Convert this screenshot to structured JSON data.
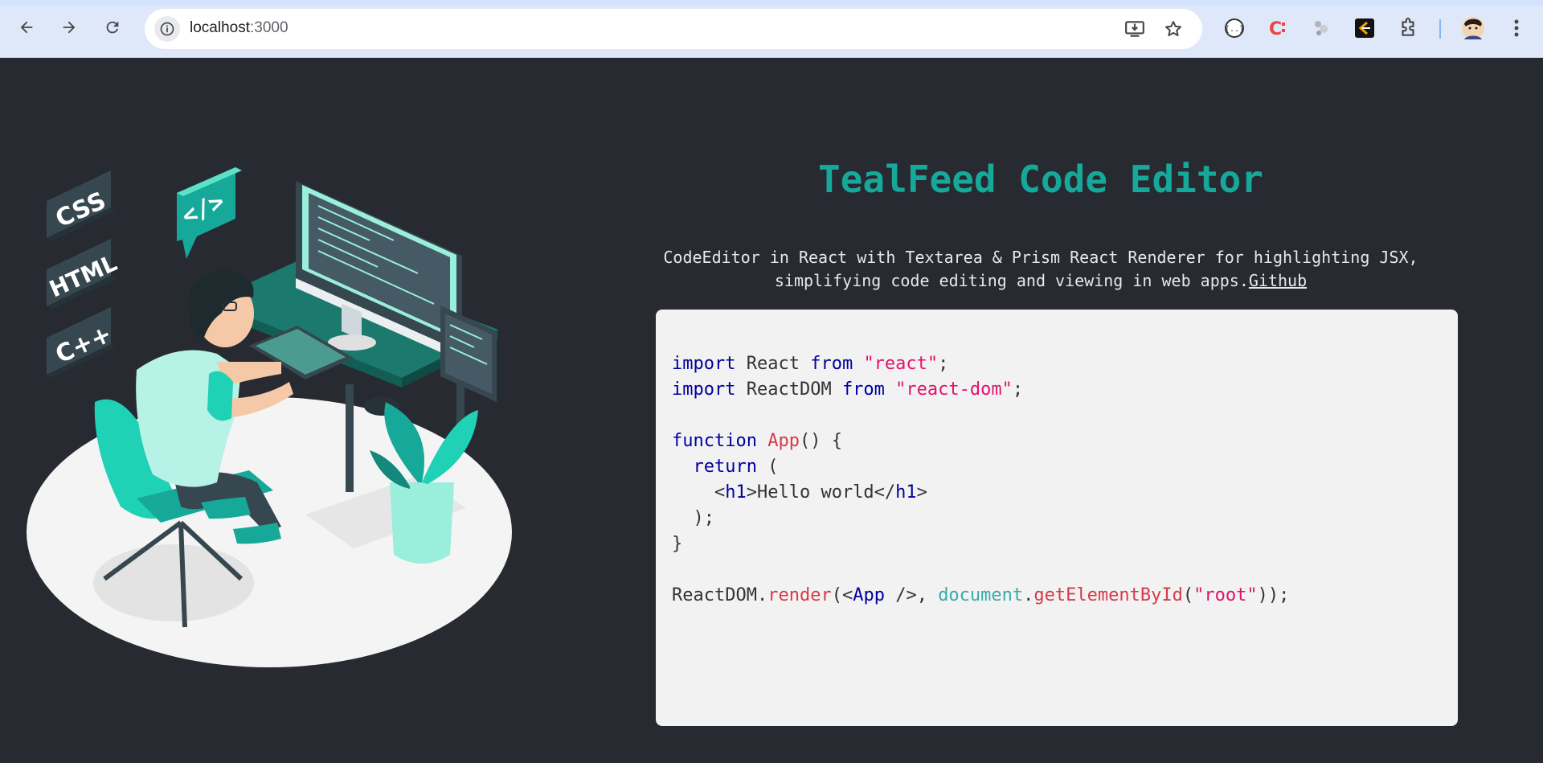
{
  "browser": {
    "url_host": "localhost",
    "url_port": ":3000",
    "nav": {
      "back": "back-icon",
      "forward": "forward-icon",
      "reload": "reload-icon"
    },
    "omnibox_icons": [
      "site-info-icon",
      "install-app-icon",
      "bookmark-star-icon"
    ],
    "extensions": [
      "json-viewer-icon",
      "cc-extension-icon",
      "gray-extension-icon",
      "code-extension-icon",
      "extensions-puzzle-icon",
      "profile-avatar-icon",
      "more-menu-icon"
    ],
    "accent": "#d3e3fd"
  },
  "page": {
    "title": "TealFeed Code Editor",
    "description_line1": "CodeEditor in React with Textarea & Prism React Renderer for highlighting JSX,",
    "description_line2": "simplifying code editing and viewing in web apps.",
    "link_label": "Github",
    "title_color": "#16a99a",
    "background": "#282a32"
  },
  "illustration": {
    "labels": [
      "CSS",
      "HTML",
      "C++",
      "</>"
    ]
  },
  "editor": {
    "l1_import": "import",
    "l1_name": " React ",
    "l1_from": "from",
    "l1_str": "\"react\"",
    "l1_semi": ";",
    "l2_import": "import",
    "l2_name": " ReactDOM ",
    "l2_from": "from",
    "l2_str": "\"react-dom\"",
    "l2_semi": ";",
    "l4_kw": "function",
    "l4_fn": "App",
    "l4_rest": "() {",
    "l5_kw": "return",
    "l5_rest": " (",
    "l6_lt": "<",
    "l6_tag": "h1",
    "l6_text": ">Hello world</",
    "l6_tag2": "h1",
    "l6_gt": ">",
    "l7": "  );",
    "l8": "}",
    "l10_obj": "ReactDOM.",
    "l10_fn": "render",
    "l10_p1": "(<",
    "l10_tag": "App",
    "l10_p2": " />, ",
    "l10_doc": "document",
    "l10_dot": ".",
    "l10_fn2": "getElementById",
    "l10_p3": "(",
    "l10_str": "\"root\"",
    "l10_p4": "));"
  }
}
